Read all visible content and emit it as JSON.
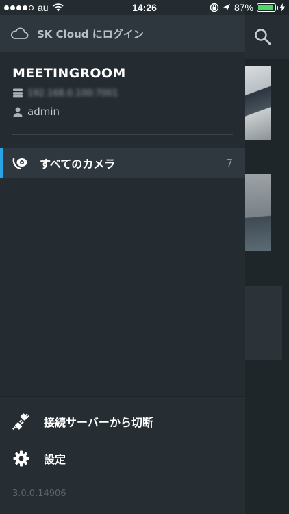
{
  "status_bar": {
    "carrier": "au",
    "time": "14:26",
    "battery_percent": "87%",
    "battery_level": 0.87
  },
  "drawer": {
    "cloud_login_label": "SK Cloud にログイン",
    "server": {
      "name": "MEETINGROOM",
      "address": "192.168.0.100:7001",
      "username": "admin"
    },
    "camera_item": {
      "label": "すべてのカメラ",
      "count": "7"
    },
    "footer": {
      "disconnect_label": "接続サーバーから切断",
      "settings_label": "設定",
      "version": "3.0.0.14906"
    }
  },
  "colors": {
    "accent": "#2aa4e8",
    "drawer_bg": "#242c31",
    "header_bg": "#2e373d"
  }
}
